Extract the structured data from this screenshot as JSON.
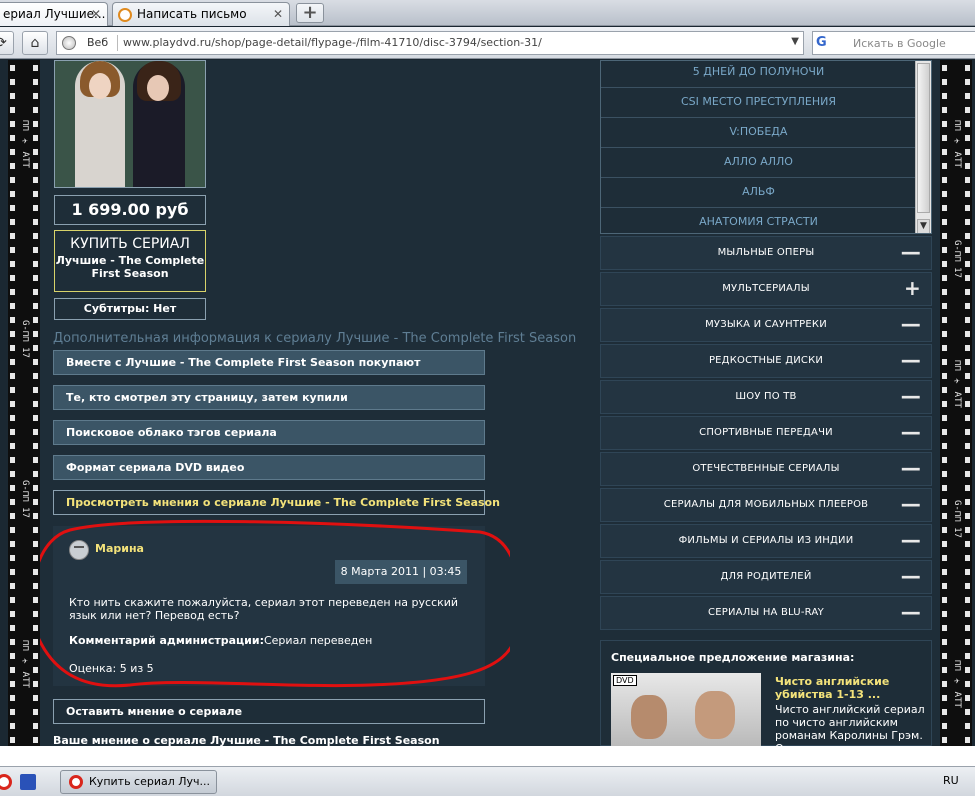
{
  "browser": {
    "tabs": [
      {
        "label": "ериал Лучшие..."
      },
      {
        "label": "Написать письмо"
      }
    ],
    "address": {
      "scope_label": "Веб",
      "url": "www.playdvd.ru/shop/page-detail/flypage-/film-41710/disc-3794/section-31/"
    },
    "search": {
      "placeholder": "Искать в Google",
      "engine": "G"
    }
  },
  "product": {
    "price": "1 699.00 руб",
    "buy_label": "КУПИТЬ СЕРИАЛ",
    "buy_title": "Лучшие - The Complete First Season",
    "subtitles": "Субтитры: Нет"
  },
  "additional_info_heading": "Дополнительная информация к сериалу Лучшие - The Complete First Season",
  "sections": [
    "Вместе с Лучшие - The Complete First Season покупают",
    "Те, кто смотрел эту страницу, затем купили",
    "Поисковое облако тэгов сериала",
    "Формат сериала DVD видео",
    "Просмотреть мнения о сериале Лучшие - The Complete First Season"
  ],
  "comment": {
    "author": "Марина",
    "date": "8 Марта 2011 | 03:45",
    "text": "Кто нить скажите пожалуйста, сериал этот переведен на русский язык или нет? Перевод есть?",
    "admin_label": "Комментарий администрации:",
    "admin_text": "Сериал переведен",
    "rating": "Оценка: 5 из 5"
  },
  "leave_review": "Оставить мнение о сериале",
  "your_opinion": "Ваше мнение о сериале Лучшие - The Complete First Season",
  "series_list": [
    "5 ДНЕЙ ДО ПОЛУНОЧИ",
    "CSI МЕСТО ПРЕСТУПЛЕНИЯ",
    "V:ПОБЕДА",
    "АЛЛО АЛЛО",
    "АЛЬФ",
    "АНАТОМИЯ СТРАСТИ"
  ],
  "categories": [
    {
      "label": "МЫЛЬНЫЕ ОПЕРЫ",
      "toggle": "—"
    },
    {
      "label": "МУЛЬТСЕРИАЛЫ",
      "toggle": "+"
    },
    {
      "label": "МУЗЫКА И САУНТРЕКИ",
      "toggle": "—"
    },
    {
      "label": "РЕДКОСТНЫЕ ДИСКИ",
      "toggle": "—"
    },
    {
      "label": "ШОУ ПО ТВ",
      "toggle": "—"
    },
    {
      "label": "СПОРТИВНЫЕ ПЕРЕДАЧИ",
      "toggle": "—"
    },
    {
      "label": "ОТЕЧЕСТВЕННЫЕ СЕРИАЛЫ",
      "toggle": "—"
    },
    {
      "label": "СЕРИАЛЫ ДЛЯ МОБИЛЬНЫХ ПЛЕЕРОВ",
      "toggle": "—"
    },
    {
      "label": "ФИЛЬМЫ И СЕРИАЛЫ ИЗ ИНДИИ",
      "toggle": "—"
    },
    {
      "label": "ДЛЯ РОДИТЕЛЕЙ",
      "toggle": "—"
    },
    {
      "label": "СЕРИАЛЫ НА BLU-RAY",
      "toggle": "—"
    }
  ],
  "special": {
    "heading": "Специальное предложение магазина:",
    "badge": "DVD",
    "title": "Чисто английские убийства 1-13 ...",
    "desc": "Чисто английский сериал по чисто английским романам Каролины Грэм. От"
  },
  "taskbar": {
    "task_label": "Купить сериал Луч...",
    "lang": "RU"
  },
  "colors": {
    "accent_yellow": "#f3e27a",
    "highlight_red": "#e01010",
    "panel": "#3b5566"
  }
}
